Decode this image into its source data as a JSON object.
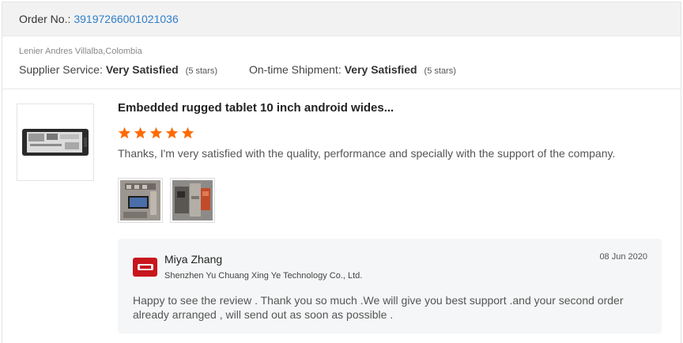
{
  "order": {
    "label": "Order No.:",
    "number": "39197266001021036"
  },
  "buyer": {
    "name_location": "Lenier Andres Villalba,Colombia"
  },
  "ratings": [
    {
      "label": "Supplier Service:",
      "value": "Very Satisfied",
      "stars": "(5 stars)"
    },
    {
      "label": "On-time Shipment:",
      "value": "Very Satisfied",
      "stars": "(5 stars)"
    }
  ],
  "product": {
    "title": "Embedded rugged tablet 10 inch android wides...",
    "star_rating": 5,
    "star_color": "#ff6a00",
    "review": "Thanks, I'm very satisfied with the quality, performance and specially with the support of the company.",
    "photo_icons": [
      "device-photo-icon",
      "machine-photo-icon"
    ]
  },
  "reply": {
    "name": "Miya Zhang",
    "company": "Shenzhen Yu Chuang Xing Ye Technology Co., Ltd.",
    "date": "08 Jun 2020",
    "text": "Happy to see the review . Thank you so much .We will give you best support .and your second order already arranged , will send out as soon as possible .",
    "logo_color": "#c8161d"
  },
  "colors": {
    "link": "#2f7fc9",
    "accent": "#ff6a00"
  }
}
